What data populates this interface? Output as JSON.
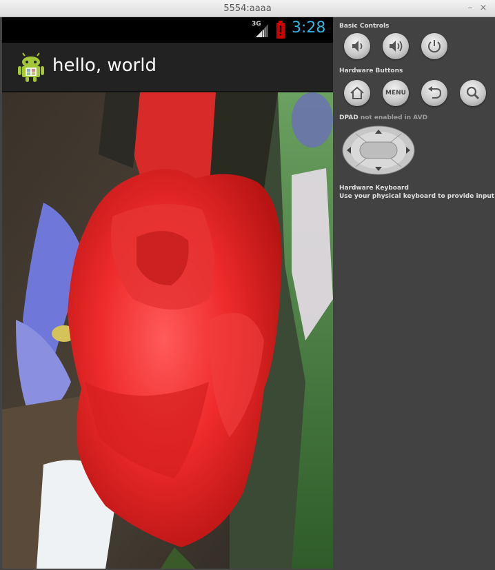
{
  "window": {
    "title": "5554:aaaa",
    "minimize_symbol": "–",
    "close_symbol": "×"
  },
  "statusbar": {
    "network": "3G",
    "time": "3:28",
    "clock_color": "#33b5e5"
  },
  "app": {
    "title": "hello, world",
    "icon": "android-robot-icon",
    "icon_color": "#a4c639"
  },
  "photo": {
    "subject": "red rose"
  },
  "controls": {
    "basic_label": "Basic Controls",
    "hardware_buttons_label": "Hardware Buttons",
    "menu_label": "MENU",
    "dpad_label": "DPAD",
    "dpad_status": "not enabled in AVD",
    "keyboard_label": "Hardware Keyboard",
    "keyboard_hint": "Use your physical keyboard to provide input",
    "icons": [
      "volume-down-icon",
      "volume-up-icon",
      "power-icon",
      "home-icon",
      "back-icon",
      "search-icon"
    ]
  }
}
